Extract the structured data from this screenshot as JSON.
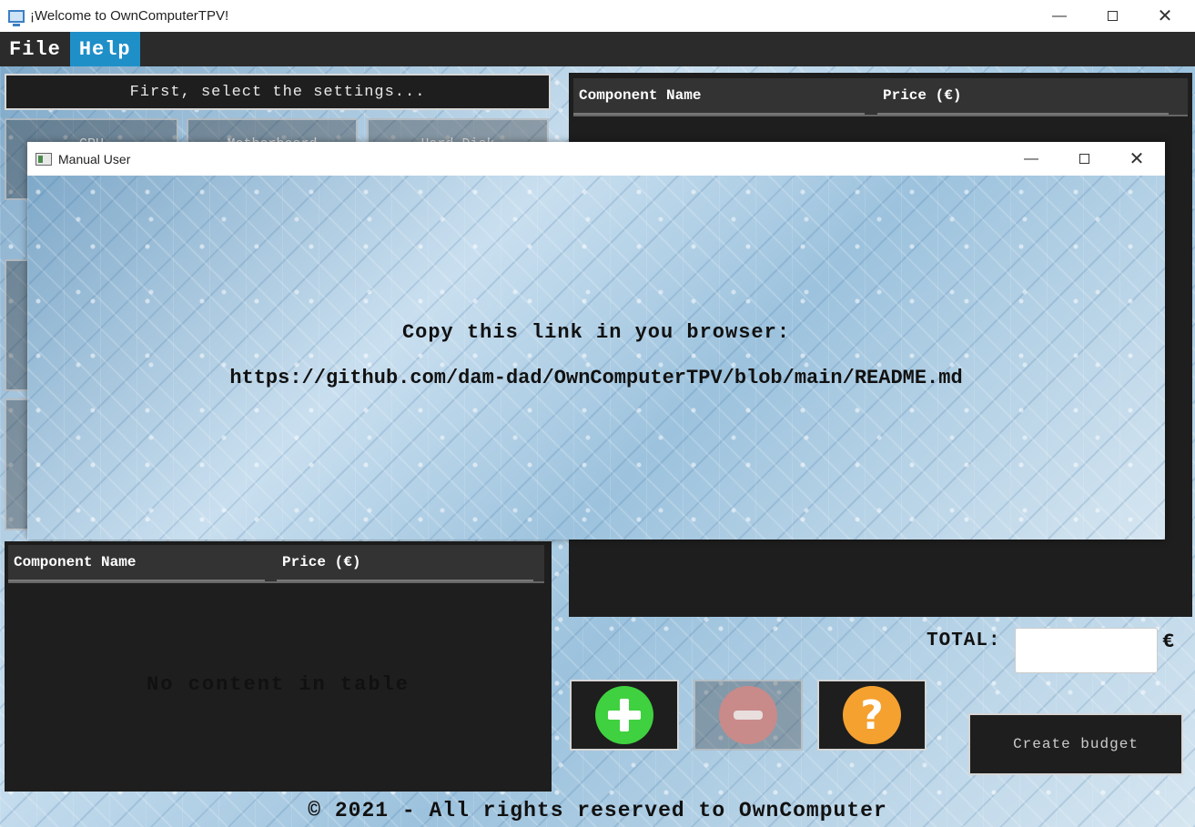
{
  "window": {
    "title": "¡Welcome to OwnComputerTPV!",
    "icon": "monitor-icon"
  },
  "menu": {
    "items": [
      {
        "label": "File"
      },
      {
        "label": "Help"
      }
    ],
    "active": "Help"
  },
  "settings": {
    "banner": "First, select the settings...",
    "categories": [
      "CPU",
      "Motherboard",
      "Hard Disk"
    ]
  },
  "right_table": {
    "columns": [
      "Component Name",
      "Price (€)"
    ]
  },
  "left_table": {
    "columns": [
      "Component Name",
      "Price (€)"
    ],
    "empty_message": "No content in table"
  },
  "total": {
    "label": "TOTAL:",
    "value": "",
    "currency": "€"
  },
  "actions": {
    "add_icon": "plus-icon",
    "remove_icon": "minus-icon",
    "help_icon": "question-icon",
    "add_color": "#3fd13f",
    "remove_color": "#c98a8a",
    "help_color": "#f5a130",
    "create_label": "Create budget"
  },
  "footer": {
    "text": "© 2021 - All rights reserved to OwnComputer"
  },
  "modal": {
    "title": "Manual User",
    "line1": "Copy this link in you browser:",
    "line2": "https://github.com/dam-dad/OwnComputerTPV/blob/main/README.md"
  }
}
